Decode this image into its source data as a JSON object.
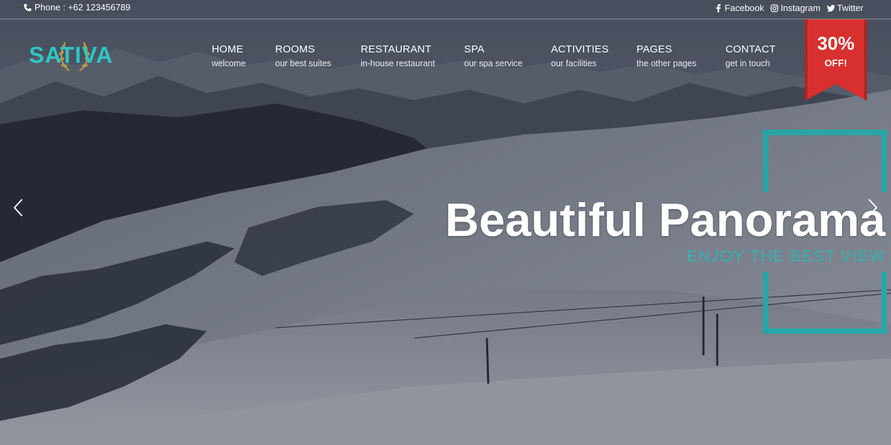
{
  "topbar": {
    "phone": "Phone : +62 123456789",
    "social": [
      {
        "label": "Facebook",
        "icon": "facebook-icon"
      },
      {
        "label": "Instagram",
        "icon": "instagram-icon"
      },
      {
        "label": "Twitter",
        "icon": "twitter-icon"
      }
    ]
  },
  "logo": {
    "text": "SATIVA"
  },
  "nav": [
    {
      "title": "HOME",
      "subtitle": "welcome"
    },
    {
      "title": "ROOMS",
      "subtitle": "our best suites"
    },
    {
      "title": "RESTAURANT",
      "subtitle": "in-house restaurant"
    },
    {
      "title": "SPA",
      "subtitle": "our spa service"
    },
    {
      "title": "ACTIVITIES",
      "subtitle": "our facilities"
    },
    {
      "title": "PAGES",
      "subtitle": "the other pages"
    },
    {
      "title": "CONTACT",
      "subtitle": "get in touch"
    }
  ],
  "ribbon": {
    "percent": "30%",
    "label": "OFF!"
  },
  "slide": {
    "title": "Beautiful Panorama",
    "subtitle": "ENJOY THE BEST VIEW"
  },
  "colors": {
    "accent": "#2fc4c4",
    "frame": "#27a6a8",
    "ribbon": "#d8302f"
  }
}
